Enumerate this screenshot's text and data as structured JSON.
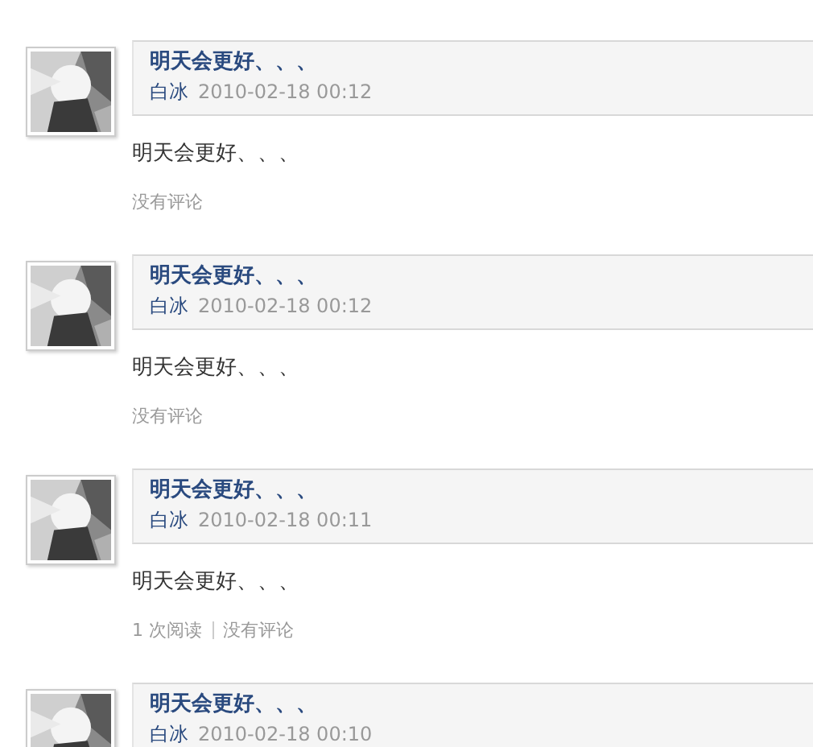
{
  "posts": [
    {
      "title": "明天会更好、、、",
      "author": "白冰",
      "time": "2010-02-18 00:12",
      "body": "明天会更好、、、",
      "meta": [
        "没有评论"
      ]
    },
    {
      "title": "明天会更好、、、",
      "author": "白冰",
      "time": "2010-02-18 00:12",
      "body": "明天会更好、、、",
      "meta": [
        "没有评论"
      ]
    },
    {
      "title": "明天会更好、、、",
      "author": "白冰",
      "time": "2010-02-18 00:11",
      "body": "明天会更好、、、",
      "meta": [
        "1 次阅读",
        "没有评论"
      ]
    },
    {
      "title": "明天会更好、、、",
      "author": "白冰",
      "time": "2010-02-18 00:10"
    }
  ]
}
